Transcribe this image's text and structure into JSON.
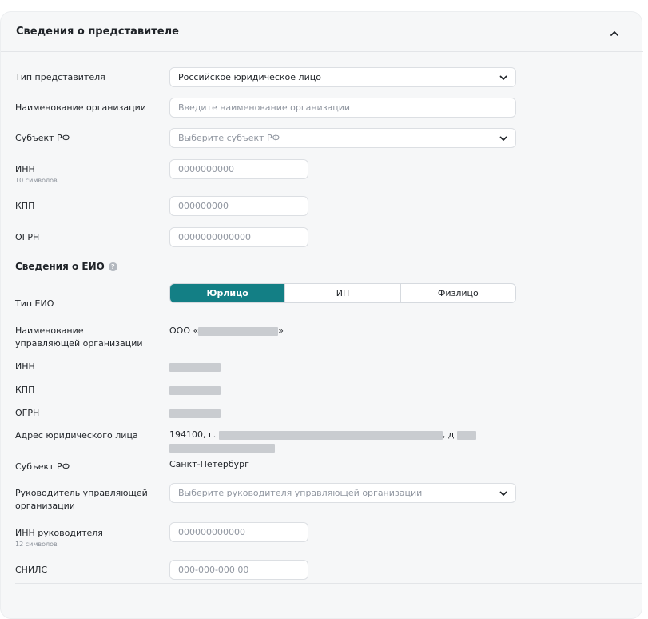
{
  "representative": {
    "title": "Сведения о представителе",
    "type_label": "Тип представителя",
    "type_value": "Российское юридическое лицо",
    "org_name_label": "Наименование организации",
    "org_name_placeholder": "Введите наименование организации",
    "subject_label": "Субъект РФ",
    "subject_placeholder": "Выберите субъект РФ",
    "inn_label": "ИНН",
    "inn_hint": "10 символов",
    "inn_placeholder": "0000000000",
    "kpp_label": "КПП",
    "kpp_placeholder": "000000000",
    "ogrn_label": "ОГРН",
    "ogrn_placeholder": "0000000000000"
  },
  "eio": {
    "title": "Сведения о ЕИО",
    "help_icon": "?",
    "type_label": "Тип ЕИО",
    "type_options": [
      "Юрлицо",
      "ИП",
      "Физлицо"
    ],
    "type_selected": "Юрлицо",
    "mgmt_org_label": "Наименование управляющей организации",
    "mgmt_org_prefix": "ООО «",
    "mgmt_org_suffix": "»",
    "inn_label": "ИНН",
    "kpp_label": "КПП",
    "ogrn_label": "ОГРН",
    "address_label": "Адрес юридического лица",
    "address_prefix": "194100, г.",
    "address_mid": ", д",
    "subject_label": "Субъект РФ",
    "subject_value": "Санкт-Петербург",
    "head_label": "Руководитель управляющей организации",
    "head_placeholder": "Выберите руководителя управляющей организации",
    "head_inn_label": "ИНН руководителя",
    "head_inn_hint": "12 символов",
    "head_inn_placeholder": "000000000000",
    "snils_label": "СНИЛС",
    "snils_placeholder": "000-000-000 00"
  },
  "colors": {
    "accent": "#137f85",
    "background": "#f6f7f8"
  }
}
